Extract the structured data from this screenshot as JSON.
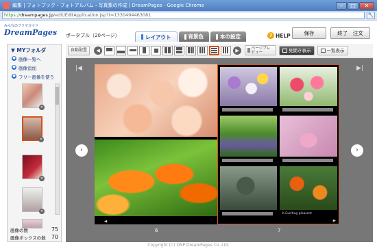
{
  "browser": {
    "title": "編集 | フォトブック・フォトアルバム・写真集の作成 | DreamPages - Google Chrome",
    "url_scheme": "https://",
    "url_host": "dreampages.jp",
    "url_path": "/edit/EditApplication.jsp?t=1330494463081",
    "min_label": "–",
    "max_label": "□",
    "close_label": "✕",
    "menu_label": "🔧"
  },
  "header": {
    "tagline": "みんなのフリマガイド",
    "brand": "DreamPages",
    "album_type": "ポータブル（20ページ）",
    "tabs": [
      {
        "label": "レイアウト"
      },
      {
        "label": "背景色"
      },
      {
        "label": "本の設定"
      }
    ],
    "help_icon": "?",
    "help_label": "HELP",
    "save_label": "保存",
    "order_label": "終了　注文"
  },
  "sidebar": {
    "title": "▼ MYフォルダ",
    "links": [
      {
        "label": "画像一覧へ"
      },
      {
        "label": "画像追加"
      },
      {
        "label": "フリー画像を使う"
      }
    ],
    "link_icon": "●",
    "remove_icon": "✕",
    "image_count_label": "画像の数",
    "image_count_value": "75",
    "box_count_label": "画像ボックスの数",
    "box_count_value": "70"
  },
  "toolbar": {
    "auto_layout_label": "自動配置",
    "prev_label": "◀",
    "next_label": "▶",
    "page_preview_label": "ページプレビュー",
    "spread_view_label": "見開き表示",
    "list_view_label": "一覧表示"
  },
  "canvas": {
    "left_page_number": "6",
    "right_page_number": "7",
    "prev_arrow": "‹",
    "next_arrow": "›",
    "first_page": "|◀",
    "last_page": "▶|",
    "left_page_nav": "◀",
    "right_page_nav": "▶",
    "right_caption": "b  Exciting pleasant"
  },
  "footer": {
    "copyright": "Copyright (C) DNP DreamPages Co.,Ltd."
  },
  "colors": {
    "accent": "#1f4f9f",
    "selected": "#d0521c",
    "canvas_bg": "#777777"
  }
}
